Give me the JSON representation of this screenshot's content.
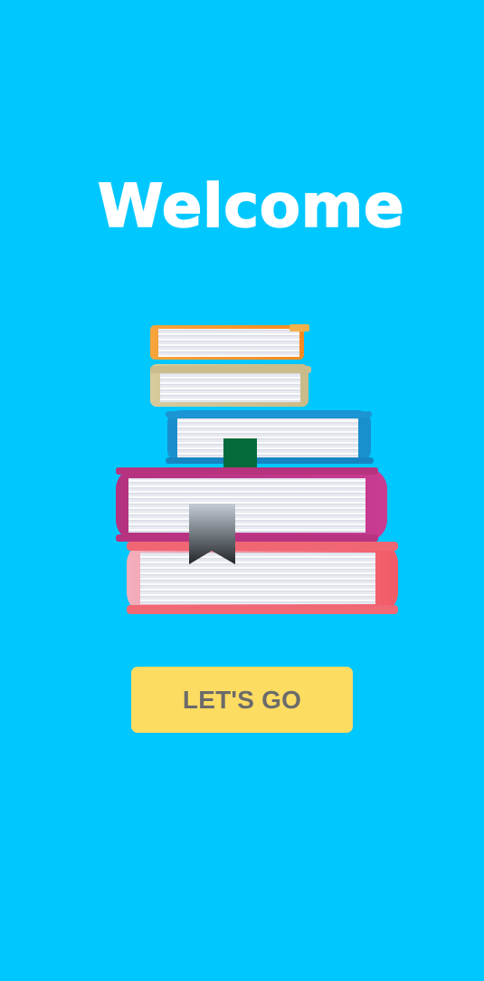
{
  "welcome": {
    "title": "Welcome"
  },
  "illustration": {
    "icon": "book-stack-icon"
  },
  "cta": {
    "label": "LET'S GO"
  },
  "colors": {
    "background": "#00c8ff",
    "title": "#ffffff",
    "button": "#fddc62",
    "button_text": "#6b6b6b"
  }
}
